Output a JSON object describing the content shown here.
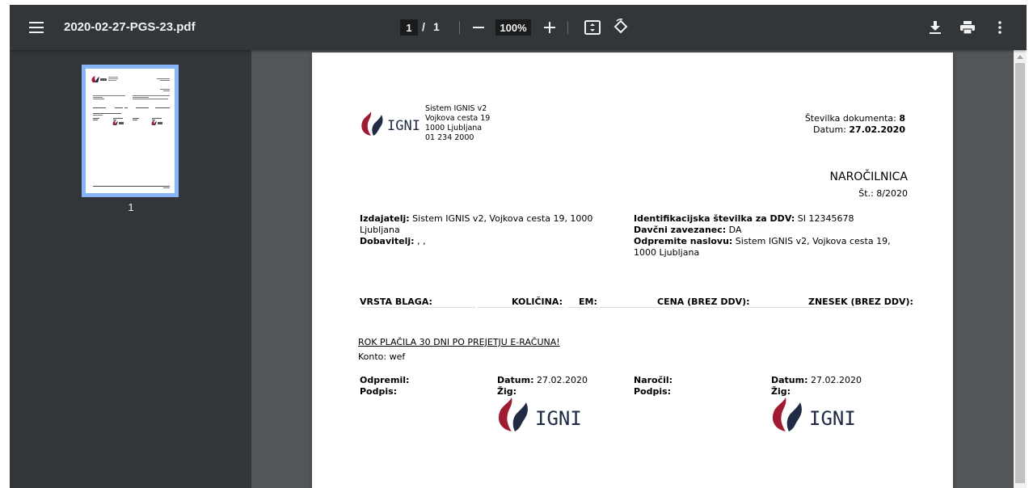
{
  "toolbar": {
    "menu_icon": "hamburger-menu-icon",
    "filename": "2020-02-27-PGS-23.pdf",
    "page_current": "1",
    "page_separator": "/",
    "page_total": "1",
    "zoom": "100%",
    "zoom_out_icon": "minus-icon",
    "zoom_in_icon": "plus-icon",
    "fit_icon": "fit-page-icon",
    "rotate_icon": "rotate-icon",
    "download_icon": "download-icon",
    "print_icon": "print-icon",
    "more_icon": "more-vert-icon"
  },
  "sidebar": {
    "thumbnail_label": "1"
  },
  "document": {
    "logo_text": "IGNIS",
    "company_lines": [
      "Sistem IGNIS v2",
      "Vojkova cesta 19",
      "1000 Ljubljana",
      "01 234 2000"
    ],
    "doc_number_label": "Številka dokumenta:",
    "doc_number_value": "8",
    "date_label": "Datum:",
    "date_value": "27.02.2020",
    "doc_title": "NAROČILNICA",
    "doc_subnumber": "Št.: 8/2020",
    "issuer_label": "Izdajatelj:",
    "issuer_value_line1": " Sistem IGNIS v2, Vojkova cesta 19, 1000",
    "issuer_value_line2": "Ljubljana",
    "supplier_label": "Dobavitelj:",
    "supplier_value": " , ,",
    "vat_label": "Identifikacijska številka za DDV:",
    "vat_value": " SI 12345678",
    "taxpayer_label": "Davčni zavezanec:",
    "taxpayer_value": " DA",
    "ship_label": "Odpremite naslovu:",
    "ship_value_line1": " Sistem IGNIS v2, Vojkova cesta 19,",
    "ship_value_line2": "1000 Ljubljana",
    "table_headers": [
      "VRSTA BLAGA:",
      "KOLIČINA:",
      "EM:",
      "CENA (BREZ DDV):",
      "ZNESEK (BREZ DDV):"
    ],
    "payment_note": "ROK PLAČILA 30 DNI PO PREJETJU E-RAČUNA!",
    "account": "Konto: wef",
    "signatures": [
      {
        "role_label": "Odpremil:",
        "sign_label": "Podpis:",
        "date_label": "Datum:",
        "date_value": " 27.02.2020",
        "stamp_label": "Žig:"
      },
      {
        "role_label": "Naročil:",
        "sign_label": "Podpis:",
        "date_label": "Datum:",
        "date_value": " 27.02.2020",
        "stamp_label": "Žig:"
      }
    ]
  },
  "colors": {
    "toolbar_bg": "#323639",
    "viewer_bg": "#525659",
    "thumb_highlight": "#8ab4f8",
    "logo_red": "#9e1b32",
    "logo_navy": "#1f2a44"
  }
}
